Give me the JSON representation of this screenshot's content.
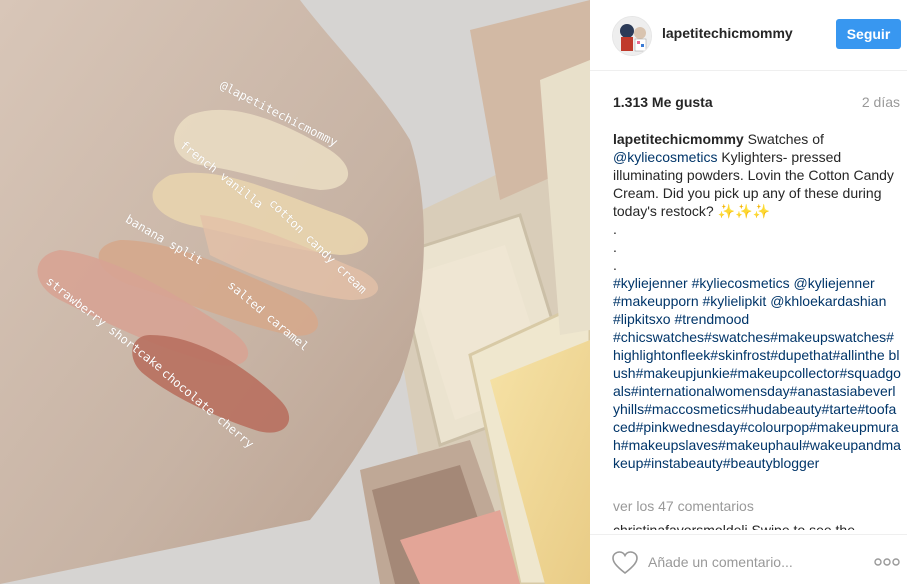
{
  "photo": {
    "labels": {
      "handle": "@lapetitechicmommy",
      "french_vanilla": "french vanilla",
      "cotton_candy": "cotton candy cream",
      "banana_split": "banana split",
      "salted_caramel": "salted caramel",
      "strawberry": "strawberry shortcake",
      "chocolate": "chocolate cherry"
    },
    "colors": {
      "skin": "#c9b6a6",
      "french_vanilla": "#e9dcc2",
      "cotton_candy": "#e4c1a8",
      "banana_split": "#e8d4ae",
      "salted_caramel": "#d5a88c",
      "strawberry": "#d7a393",
      "chocolate": "#b8705f",
      "palette_cream": "#ebe3cf",
      "palette_gold": "#f2dca0",
      "palette_pink": "#e3a597"
    }
  },
  "header": {
    "username": "lapetitechicmommy",
    "follow_label": "Seguir"
  },
  "stats": {
    "likes": "1.313 Me gusta",
    "date": "2 días"
  },
  "caption": {
    "username": "lapetitechicmommy",
    "text_before": " Swatches of ",
    "mention": "@kyliecosmetics",
    "text_after": " Kylighters- pressed illuminating powders. Lovin the Cotton Candy Cream. Did you pick up any of these during today's restock? ✨✨✨",
    "dots": [
      ".",
      ".",
      "."
    ],
    "tags_line1": "#kyliejenner #kyliecosmetics @kyliejenner #makeupporn #kylielipkit @khloekardashian #lipkitsxo #trendmood",
    "tags_line2": "#chicswatches#swatches#makeupswatches#highlightonfleek#skinfrost#dupethat#allinthe blush#makeupjunkie#makeupcollector#squadgoals#internationalwomensday#anastasiabeverlyhills#maccosmetics#hudabeauty#tarte#toofaced#pinkwednesday#colourpop#makeupmurah#makeupslaves#makeuphaul#wakeupandmakeup#instabeauty#beautyblogger"
  },
  "comments": {
    "view_all": "ver los 47 comentarios",
    "cut_off": "christinafavorsmoldeli Swipe to see the shades"
  },
  "footer": {
    "comment_placeholder": "Añade un comentario..."
  },
  "icons": {
    "heart": "heart-icon",
    "more": "more-options-icon"
  }
}
